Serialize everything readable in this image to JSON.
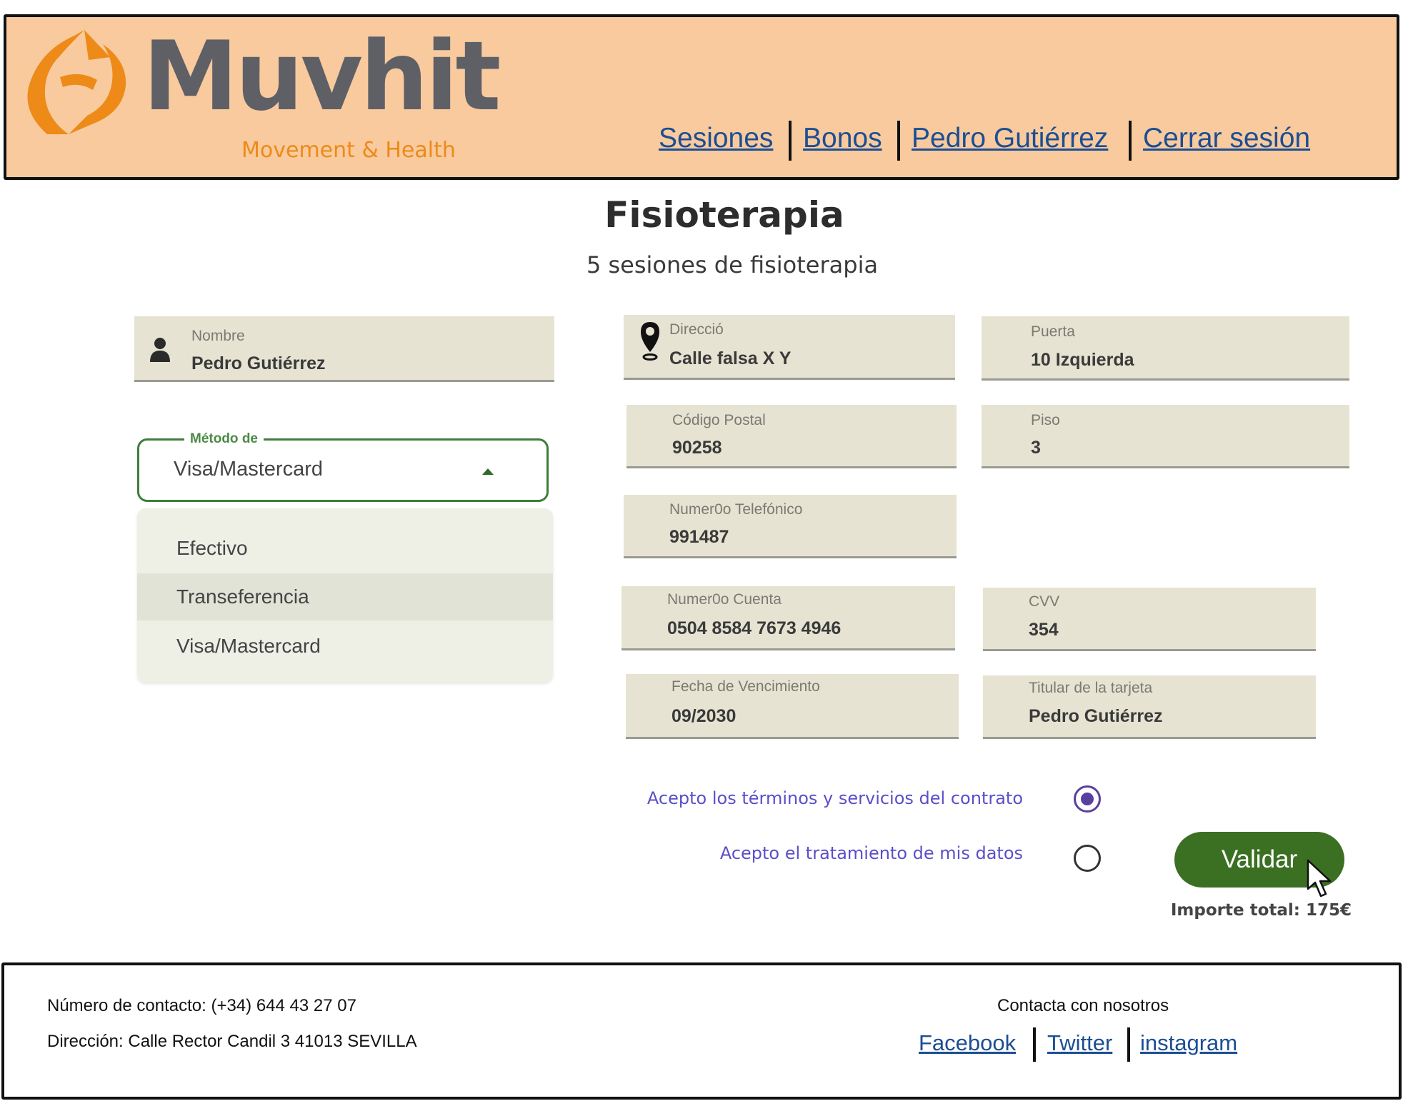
{
  "header": {
    "logo": {
      "name": "Muvhit",
      "tagline": "Movement & Health"
    },
    "nav": [
      "Sesiones",
      "Bonos",
      "Pedro Gutiérrez",
      "Cerrar sesión"
    ]
  },
  "page": {
    "title": "Fisioterapia",
    "subtitle": "5 sesiones de fisioterapia"
  },
  "form": {
    "nombre": {
      "label": "Nombre",
      "value": "Pedro Gutiérrez",
      "icon": "user-icon"
    },
    "direccion": {
      "label": "Direcció",
      "value": "Calle falsa X Y",
      "icon": "map-pin-icon"
    },
    "puerta": {
      "label": "Puerta",
      "value": "10 Izquierda"
    },
    "codigo_postal": {
      "label": "Código Postal",
      "value": "90258"
    },
    "piso": {
      "label": "Piso",
      "value": "3"
    },
    "telefono": {
      "label": "Numer0o Telefónico",
      "value": "991487"
    },
    "cuenta": {
      "label": "Numer0o Cuenta",
      "value": "0504 8584 7673 4946"
    },
    "cvv": {
      "label": "CVV",
      "value": "354"
    },
    "vencimiento": {
      "label": "Fecha de Vencimiento",
      "value": "09/2030"
    },
    "titular": {
      "label": "Titular de la tarjeta",
      "value": "Pedro Gutiérrez"
    }
  },
  "payment": {
    "label": "Método de",
    "selected": "Visa/Mastercard",
    "options": [
      "Efectivo",
      "Transeferencia",
      "Visa/Mastercard"
    ],
    "highlighted_option": "Transeferencia"
  },
  "consents": [
    {
      "label": "Acepto los términos y servicios del contrato",
      "checked": true
    },
    {
      "label": "Acepto el tratamiento de mis datos",
      "checked": false
    }
  ],
  "actions": {
    "validate_label": "Validar",
    "total": "Importe total: 175€"
  },
  "footer": {
    "contact_number": "Número de contacto:  (+34) 644 43 27 07",
    "address": "Dirección: Calle Rector Candil 3 41013 SEVILLA",
    "contact_heading": "Contacta con nosotros",
    "social": [
      "Facebook",
      "Twitter",
      "instagram"
    ]
  },
  "colors": {
    "header_bg": "#f8ca9e",
    "field_bg": "#e6e3d2",
    "accent_green": "#3b6f22",
    "link_blue": "#1c4e93",
    "consent_purple": "#5a4fc9",
    "logo_orange": "#ee8a18",
    "logo_gray": "#5f6066"
  }
}
